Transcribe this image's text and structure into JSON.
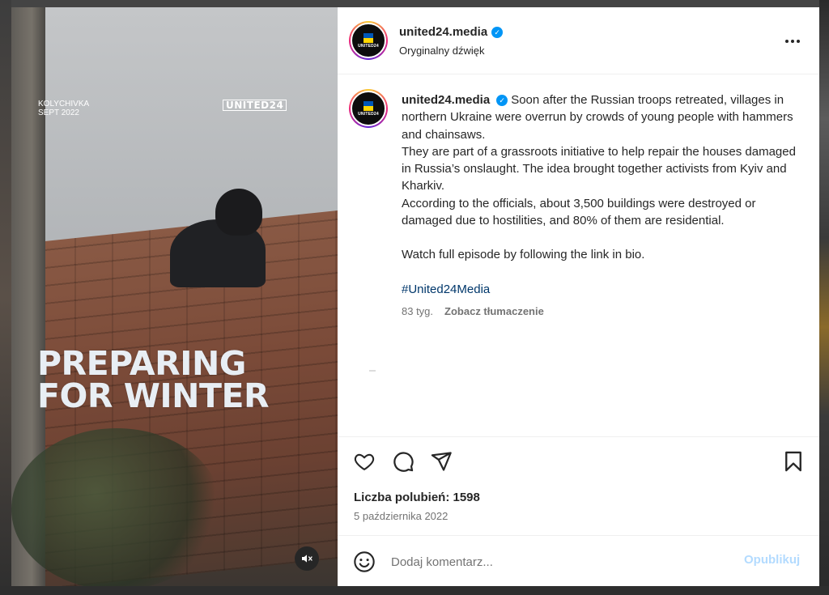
{
  "media": {
    "location_line1": "KOLYCHIVKA",
    "location_line2": "SEPT 2022",
    "brand": "UNITED24",
    "headline_line1": "PREPARING",
    "headline_line2": "FOR WINTER",
    "mute_icon": "speaker-muted-icon"
  },
  "header": {
    "avatar_text": "UNITED24",
    "username": "united24.media",
    "verified_icon": "verified-badge-icon",
    "audio": "Oryginalny dźwięk",
    "more_icon": "more-options-icon"
  },
  "caption": {
    "username": "united24.media",
    "p1": "Soon after the Russian troops retreated, villages in northern Ukraine were overrun by crowds of young people with hammers and chainsaws.",
    "p2": "They are part of a grassroots initiative to help repair the houses damaged in Russia’s onslaught. The idea brought together activists from Kyiv and Kharkiv.",
    "p3": "According to the officials, about 3,500 buildings were destroyed or damaged due to hostilities, and 80% of them are residential.",
    "p4": "Watch full episode by following the link in bio.",
    "hashtag": "#United24Media",
    "age": "83 tyg.",
    "translate": "Zobacz tłumaczenie"
  },
  "actions": {
    "like_icon": "heart-icon",
    "comment_icon": "comment-bubble-icon",
    "share_icon": "paper-plane-icon",
    "save_icon": "bookmark-icon"
  },
  "likes": "Liczba polubień: 1598",
  "date": "5 października 2022",
  "comment": {
    "emoji_icon": "smiley-icon",
    "placeholder": "Dodaj komentarz...",
    "publish": "Opublikuj"
  },
  "colors": {
    "accent": "#0095f6",
    "link": "#00376b",
    "publish_disabled": "#b3dbff"
  }
}
